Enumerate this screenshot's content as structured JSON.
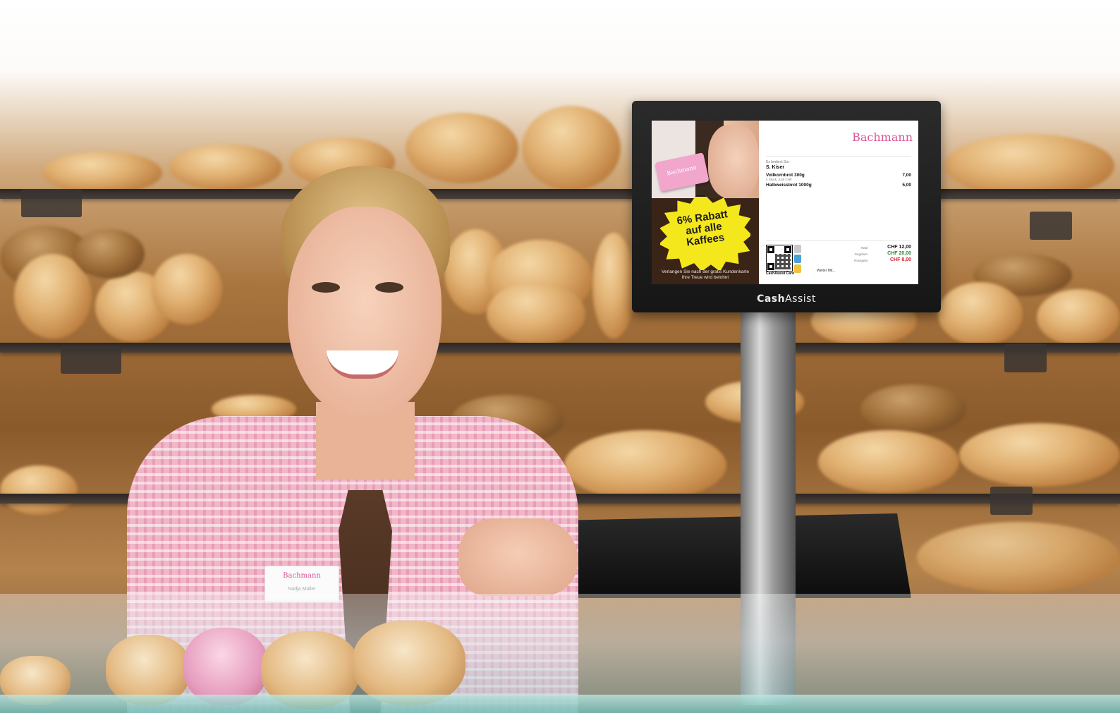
{
  "scene": {
    "description_tags": [
      "bakery-counter",
      "cashier",
      "customer-display",
      "pos-terminal"
    ]
  },
  "monitor": {
    "brand_prefix": "Cash",
    "brand_suffix": "Assist"
  },
  "ad": {
    "card_logo": "Bachmann",
    "promo_line1": "6% Rabatt",
    "promo_line2": "auf alle",
    "promo_line3": "Kaffees",
    "caption_line1": "Verlangen Sie nach der gratis Kundenkarte",
    "caption_line2": "Ihre Treue wird belohnt"
  },
  "receipt": {
    "brand_logo": "Bachmann",
    "served_by": "Es bedient Sie:",
    "cashier_name": "S. Kiser",
    "items": [
      {
        "name": "Vollkornbrot 300g",
        "sub": "2 Stück, 3,50 CHF",
        "price": "7,00"
      },
      {
        "name": "Halbweissbrot 1000g",
        "sub": "",
        "price": "5,00"
      }
    ],
    "card_label": "CashAssist Card",
    "weiter_label": "Weiter Mit...",
    "totals": [
      {
        "label": "Total",
        "value": "CHF 12,00",
        "color": "#1a1a1a"
      },
      {
        "label": "Gegeben",
        "value": "CHF 20,00",
        "color": "#2e8b3a"
      },
      {
        "label": "Rückgeld",
        "value": "CHF 8,00",
        "color": "#d4202a"
      }
    ]
  },
  "badge": {
    "logo": "Bachmann",
    "name": "Nadja Müller"
  },
  "colors": {
    "brand_pink": "#d9559a",
    "promo_yellow": "#f4e81d"
  }
}
